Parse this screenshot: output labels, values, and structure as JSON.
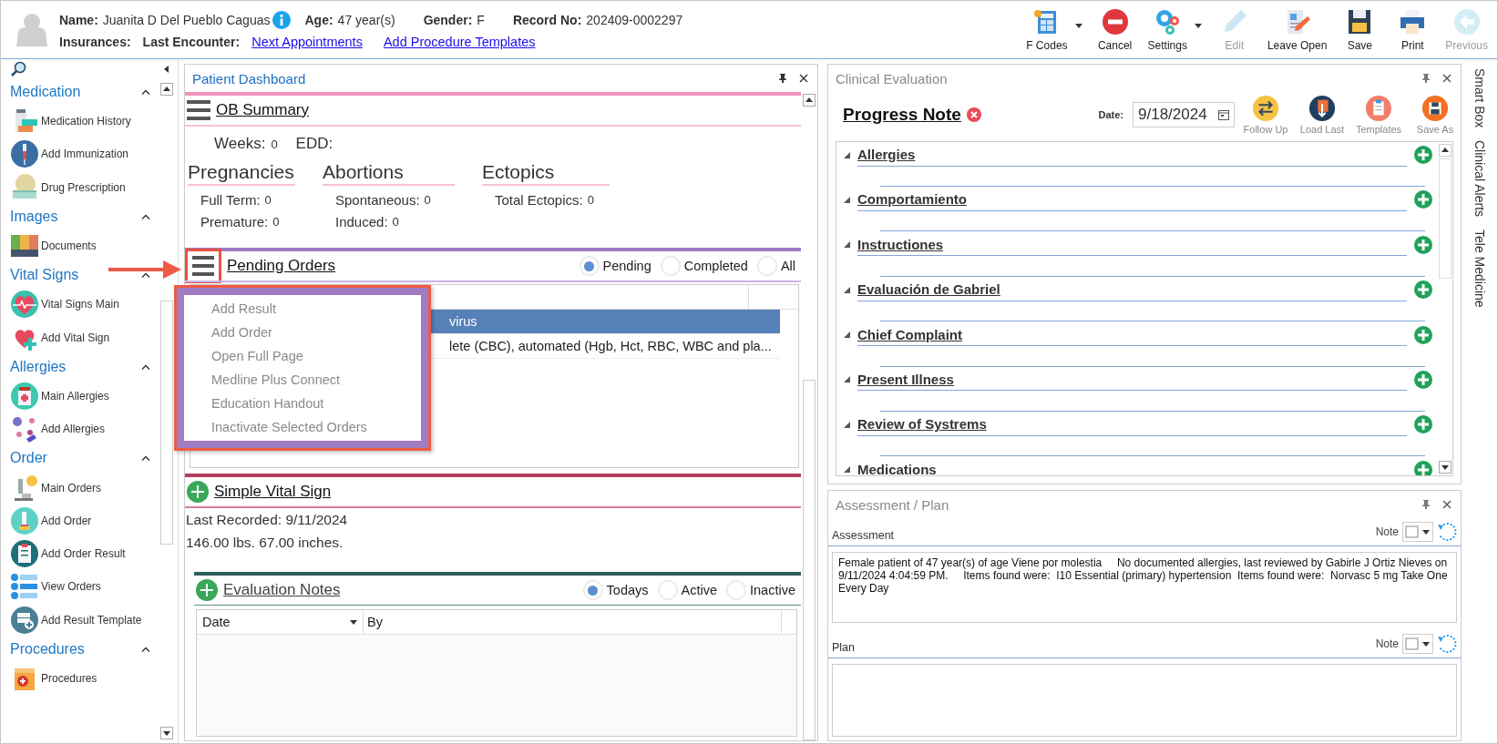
{
  "patient": {
    "name_label": "Name:",
    "name": "Juanita D Del Pueblo Caguas",
    "age_label": "Age:",
    "age": "47 year(s)",
    "gender_label": "Gender:",
    "gender": "F",
    "record_label": "Record No:",
    "record": "202409-0002297",
    "insurances_label": "Insurances:",
    "last_encounter_label": "Last Encounter:",
    "links": [
      "Next Appointments",
      "Add Procedure Templates"
    ]
  },
  "toolbar": [
    {
      "label": "F Codes",
      "disabled": false,
      "dropdown": true
    },
    {
      "label": "Cancel",
      "disabled": false,
      "dropdown": false
    },
    {
      "label": "Settings",
      "disabled": false,
      "dropdown": true
    },
    {
      "label": "Edit",
      "disabled": true,
      "dropdown": false
    },
    {
      "label": "Leave Open",
      "disabled": false,
      "dropdown": false
    },
    {
      "label": "Save",
      "disabled": false,
      "dropdown": false
    },
    {
      "label": "Print",
      "disabled": false,
      "dropdown": false
    },
    {
      "label": "Previous",
      "disabled": true,
      "dropdown": false
    }
  ],
  "sidebar": {
    "groups": [
      {
        "title": "Medication",
        "expanded": true,
        "items": [
          "Medication History",
          "Add Immunization",
          "Drug Prescription"
        ]
      },
      {
        "title": "Images",
        "expanded": true,
        "items": [
          "Documents"
        ]
      },
      {
        "title": "Vital Signs",
        "expanded": true,
        "items": [
          "Vital Signs Main",
          "Add Vital Sign"
        ]
      },
      {
        "title": "Allergies",
        "expanded": true,
        "items": [
          "Main Allergies",
          "Add Allergies"
        ]
      },
      {
        "title": "Order",
        "expanded": true,
        "items": [
          "Main Orders",
          "Add Order",
          "Add Order Result",
          "View Orders",
          "Add Result Template"
        ]
      },
      {
        "title": "Procedures",
        "expanded": true,
        "items": [
          "Procedures"
        ]
      }
    ]
  },
  "dashboard": {
    "title": "Patient Dashboard",
    "ob_summary": {
      "title": "OB Summary",
      "weeks_label": "Weeks:",
      "weeks": "0",
      "edd_label": "EDD:",
      "groups": [
        {
          "title": "Pregnancies",
          "rows": [
            {
              "label": "Full Term:",
              "value": "0"
            },
            {
              "label": "Premature:",
              "value": "0"
            }
          ]
        },
        {
          "title": "Abortions",
          "rows": [
            {
              "label": "Spontaneous:",
              "value": "0"
            },
            {
              "label": "Induced:",
              "value": "0"
            }
          ]
        },
        {
          "title": "Ectopics",
          "rows": [
            {
              "label": "Total Ectopics:",
              "value": "0"
            }
          ]
        }
      ]
    },
    "pending_orders": {
      "title": "Pending Orders",
      "filters": [
        {
          "label": "Pending",
          "selected": true
        },
        {
          "label": "Completed",
          "selected": false
        },
        {
          "label": "All",
          "selected": false
        }
      ],
      "rows": [
        {
          "text": "virus",
          "selected": true
        },
        {
          "text": "lete (CBC), automated (Hgb, Hct, RBC, WBC and pla...",
          "selected": false
        }
      ],
      "menu": [
        {
          "label": "Add Result",
          "disabled": true
        },
        {
          "label": "Add Order",
          "disabled": true
        },
        {
          "label": "Open Full Page",
          "disabled": true
        },
        {
          "label": "Medline Plus Connect",
          "disabled": true
        },
        {
          "label": "Education Handout",
          "disabled": true
        },
        {
          "label": "Inactivate Selected Orders",
          "disabled": true
        }
      ]
    },
    "vital_sign": {
      "title": "Simple Vital Sign",
      "lines": [
        "Last Recorded: 9/11/2024",
        "146.00 lbs. 67.00 inches."
      ]
    },
    "evaluation_notes": {
      "title": "Evaluation Notes",
      "filters": [
        {
          "label": "Todays",
          "selected": true
        },
        {
          "label": "Active",
          "selected": false
        },
        {
          "label": "Inactive",
          "selected": false
        }
      ],
      "columns": [
        "Date",
        "By"
      ]
    }
  },
  "clinical": {
    "title": "Clinical Evaluation",
    "note_title": "Progress Note",
    "date_label": "Date:",
    "date": "9/18/2024",
    "actions": [
      "Follow Up",
      "Load Last",
      "Templates",
      "Save As"
    ],
    "sections": [
      {
        "title": "Allergies",
        "expanded": true
      },
      {
        "title": "Comportamiento",
        "expanded": true
      },
      {
        "title": "Instructiones",
        "expanded": true
      },
      {
        "title": "Evaluación de Gabriel",
        "expanded": true
      },
      {
        "title": "Chief Complaint",
        "expanded": true
      },
      {
        "title": "Present Illness",
        "expanded": true
      },
      {
        "title": "Review of Systrems",
        "expanded": true
      },
      {
        "title": "Medications",
        "expanded": true
      }
    ]
  },
  "assessment_plan": {
    "title": "Assessment / Plan",
    "assessment_label": "Assessment",
    "assessment_note_label": "Note",
    "assessment_text": "Female patient of 47 year(s) of age Viene por molestia     No documented allergies, last reviewed by Gabirle J Ortiz Nieves on 9/11/2024 4:04:59 PM.     Items found were:  I10 Essential (primary) hypertension  Items found were:  Norvasc 5 mg Take One Every Day",
    "plan_label": "Plan",
    "plan_note_label": "Note"
  },
  "side_tabs": [
    "Smart Box",
    "Clinical Alerts",
    "Tele Medicine"
  ]
}
